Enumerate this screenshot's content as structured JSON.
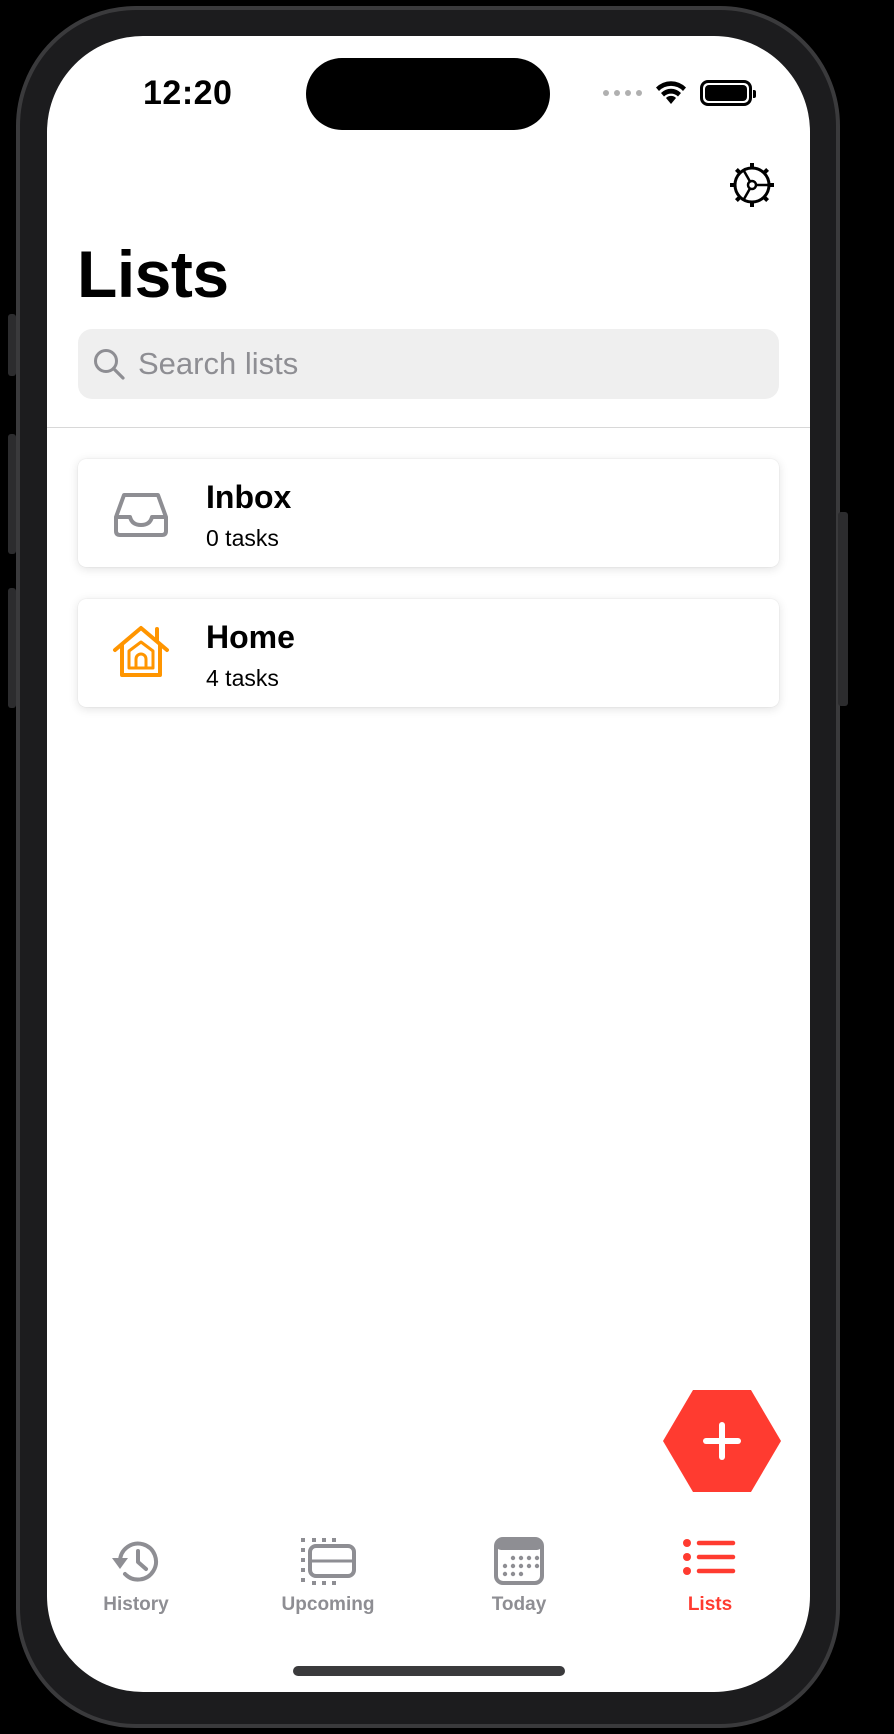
{
  "status_bar": {
    "time": "12:20"
  },
  "header": {
    "title": "Lists",
    "settings_icon": "gear-icon"
  },
  "search": {
    "placeholder": "Search lists",
    "value": "",
    "icon": "search-icon"
  },
  "lists": [
    {
      "title": "Inbox",
      "subtitle": "0 tasks",
      "icon": "inbox-tray-icon",
      "icon_color": "#8e8e93"
    },
    {
      "title": "Home",
      "subtitle": "4 tasks",
      "icon": "house-icon",
      "icon_color": "#ff9500"
    }
  ],
  "fab": {
    "icon": "plus-icon",
    "color": "#ff3b30"
  },
  "tabs": [
    {
      "label": "History",
      "icon": "history-clock-icon",
      "active": false
    },
    {
      "label": "Upcoming",
      "icon": "upcoming-stack-icon",
      "active": false
    },
    {
      "label": "Today",
      "icon": "calendar-icon",
      "active": false
    },
    {
      "label": "Lists",
      "icon": "bulleted-list-icon",
      "active": true
    }
  ],
  "colors": {
    "accent": "#ff3b30",
    "inactive": "#8e8e93",
    "home_icon": "#ff9500"
  }
}
